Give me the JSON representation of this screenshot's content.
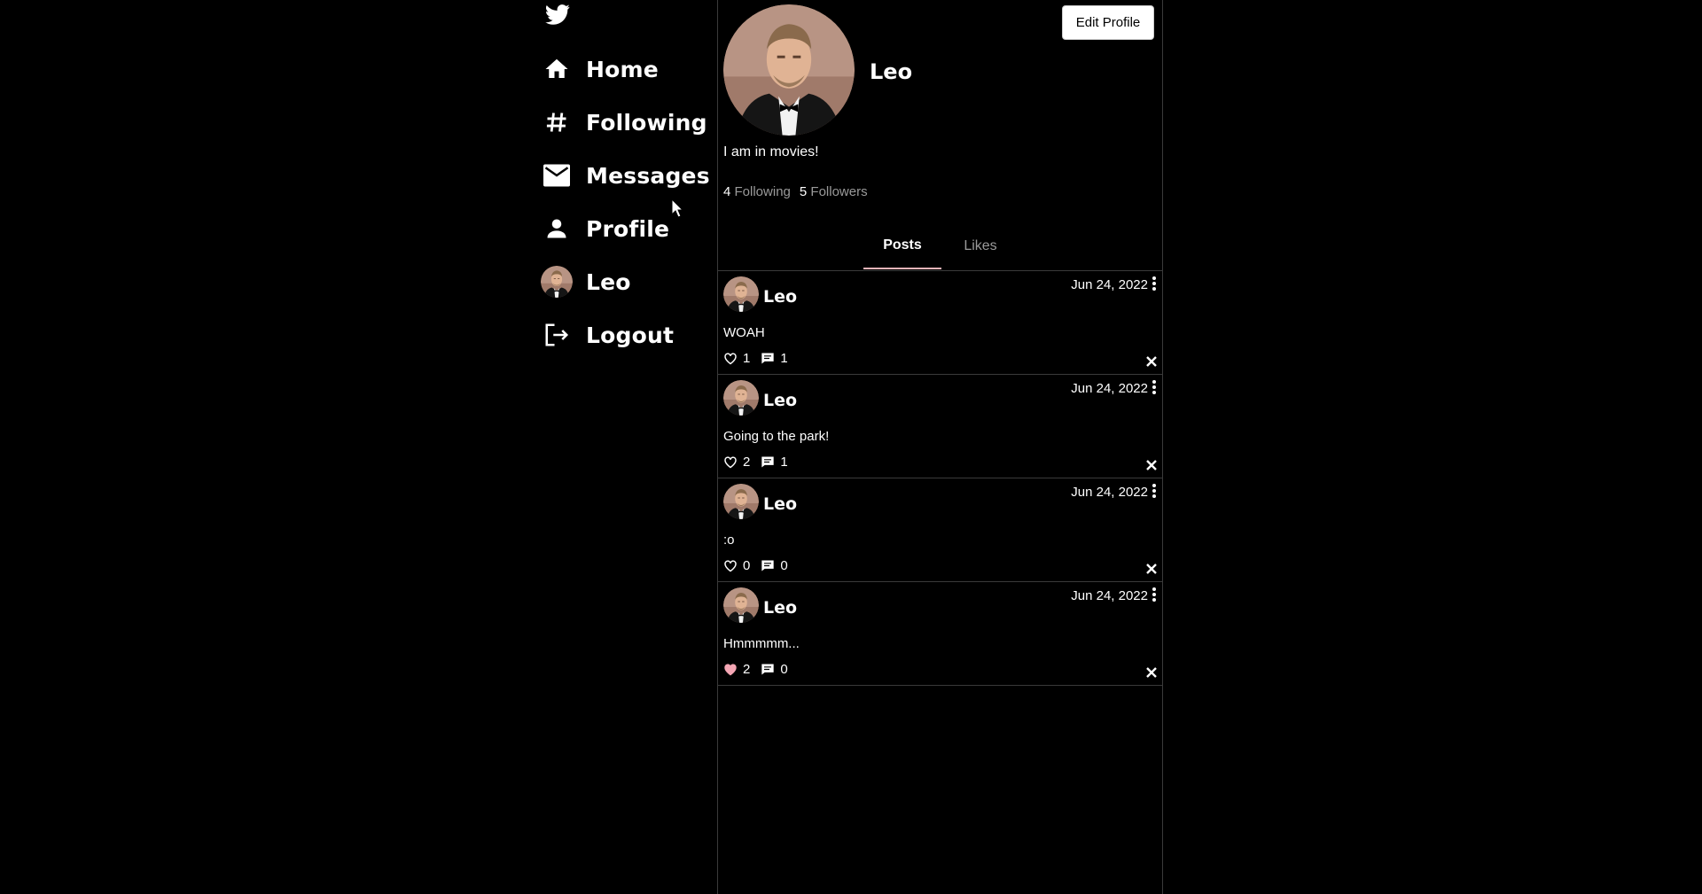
{
  "sidebar": {
    "logo_icon": "twitter-bird-icon",
    "items": [
      {
        "label": "Home",
        "icon": "home-icon"
      },
      {
        "label": "Following",
        "icon": "hash-icon"
      },
      {
        "label": "Messages",
        "icon": "mail-icon"
      },
      {
        "label": "Profile",
        "icon": "person-icon"
      },
      {
        "label": "Leo",
        "icon": "avatar"
      },
      {
        "label": "Logout",
        "icon": "logout-icon"
      }
    ]
  },
  "profile": {
    "name": "Leo",
    "bio": "I am in movies!",
    "following_count": "4",
    "following_label": "Following",
    "followers_count": "5",
    "followers_label": "Followers",
    "edit_button_label": "Edit Profile"
  },
  "tabs": [
    {
      "label": "Posts",
      "active": true
    },
    {
      "label": "Likes",
      "active": false
    }
  ],
  "posts": [
    {
      "author": "Leo",
      "date": "Jun 24, 2022",
      "text": "WOAH",
      "likes": "1",
      "comments": "1",
      "liked": false
    },
    {
      "author": "Leo",
      "date": "Jun 24, 2022",
      "text": "Going to the park!",
      "likes": "2",
      "comments": "1",
      "liked": false
    },
    {
      "author": "Leo",
      "date": "Jun 24, 2022",
      "text": ":o",
      "likes": "0",
      "comments": "0",
      "liked": false
    },
    {
      "author": "Leo",
      "date": "Jun 24, 2022",
      "text": "Hmmmmm...",
      "likes": "2",
      "comments": "0",
      "liked": true
    }
  ],
  "colors": {
    "background": "#000000",
    "text": "#ffffff",
    "muted": "#9a9a9a",
    "border": "#3a3a3a",
    "tab_indicator": "#e8b4b8",
    "liked_heart": "#f4a6b4"
  }
}
